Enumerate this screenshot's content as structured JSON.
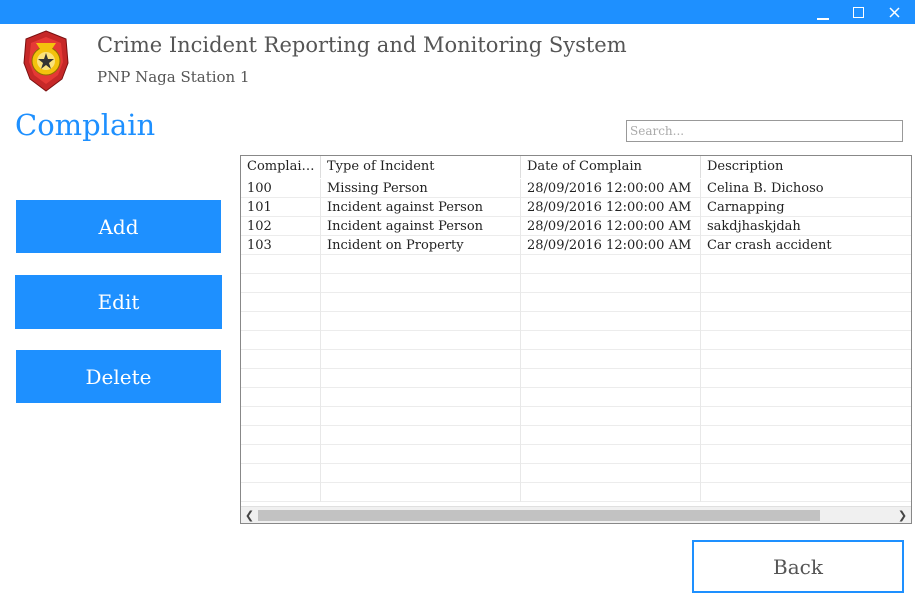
{
  "header": {
    "title": "Crime Incident Reporting and Monitoring System",
    "subtitle": "PNP Naga Station 1",
    "logo_icon": "pnp-badge-logo"
  },
  "window_controls": [
    "minimize-icon",
    "maximize-icon",
    "close-icon"
  ],
  "section": {
    "title": "Complain"
  },
  "search": {
    "placeholder": "Search...",
    "value": ""
  },
  "actions": {
    "add": "Add",
    "edit": "Edit",
    "delete": "Delete",
    "back": "Back"
  },
  "table": {
    "columns": [
      "Complain...",
      "Type of Incident",
      "Date of Complain",
      "Description"
    ],
    "rows": [
      [
        "100",
        "Missing Person",
        "28/09/2016 12:00:00 AM",
        "Celina B. Dichoso"
      ],
      [
        "101",
        "Incident against Person",
        "28/09/2016 12:00:00 AM",
        "Carnapping"
      ],
      [
        "102",
        "Incident against Person",
        "28/09/2016 12:00:00 AM",
        "sakdjhaskjdah"
      ],
      [
        "103",
        "Incident on Property",
        "28/09/2016 12:00:00 AM",
        "Car crash accident"
      ]
    ]
  },
  "colors": {
    "accent": "#1e90ff",
    "text": "#555555"
  }
}
